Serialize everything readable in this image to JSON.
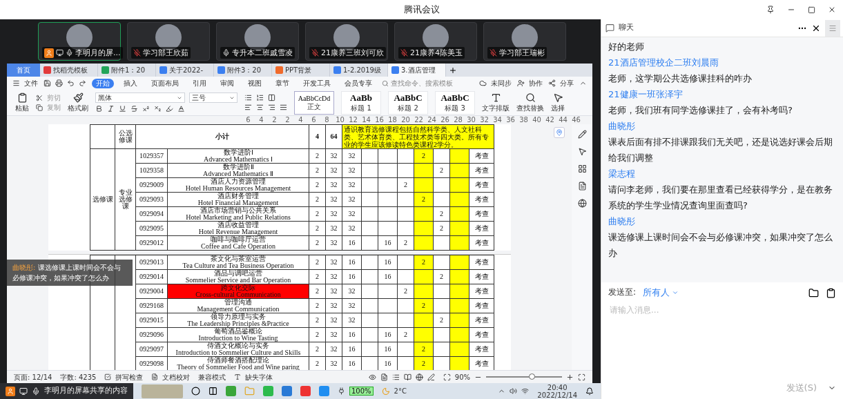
{
  "window": {
    "title": "腾讯会议"
  },
  "participants": [
    {
      "name": "李明月的屏...",
      "muted": false,
      "selected": true,
      "sharing": true
    },
    {
      "name": "学习部王欣茹",
      "muted": true,
      "selected": false,
      "sharing": false
    },
    {
      "name": "专升本二班戚雪凌",
      "muted": false,
      "selected": false,
      "sharing": false
    },
    {
      "name": "21康养三班刘可欣",
      "muted": true,
      "selected": false,
      "sharing": false
    },
    {
      "name": "21康养4陈美玉",
      "muted": true,
      "selected": false,
      "sharing": false
    },
    {
      "name": "学习部王瑞彬",
      "muted": true,
      "selected": false,
      "sharing": false
    }
  ],
  "wps": {
    "home_tab": "首页",
    "doc_tabs": [
      {
        "kind": "template",
        "label": "找稻壳模板",
        "selected": false
      },
      {
        "kind": "sheet",
        "label": "附件1：20",
        "selected": false
      },
      {
        "kind": "doc",
        "label": "关于2022-",
        "selected": false
      },
      {
        "kind": "doc",
        "label": "附件3：20",
        "selected": false
      },
      {
        "kind": "ppt",
        "label": "PPT背景",
        "selected": false
      },
      {
        "kind": "doc",
        "label": "1-2.2019级",
        "selected": false
      },
      {
        "kind": "doc",
        "label": "3.酒店管理",
        "selected": true
      }
    ],
    "file_menu": "文件",
    "ribbon_tabs": [
      {
        "label": "开始",
        "selected": true
      },
      {
        "label": "插入",
        "selected": false
      },
      {
        "label": "页面布局",
        "selected": false
      },
      {
        "label": "引用",
        "selected": false
      },
      {
        "label": "审阅",
        "selected": false
      },
      {
        "label": "视图",
        "selected": false
      },
      {
        "label": "章节",
        "selected": false
      },
      {
        "label": "开发工具",
        "selected": false
      },
      {
        "label": "会员专享",
        "selected": false
      }
    ],
    "command_search": {
      "placeholder": "查找命令、搜索模板"
    },
    "sync": "未同步",
    "collab": "协作",
    "share": "分享",
    "clipboard": {
      "paste": "粘贴",
      "cut": "剪切",
      "copy": "复制",
      "format_painter": "格式刷"
    },
    "font": {
      "family": "黑体",
      "size": "三号"
    },
    "styles": [
      {
        "preview": "AaBbCcDd",
        "label": "正文"
      },
      {
        "preview": "AaBb",
        "label": "标题 1"
      },
      {
        "preview": "AaBbC",
        "label": "标题 2"
      },
      {
        "preview": "AaBbC",
        "label": "标题 3"
      }
    ],
    "text_layout": "文字排版",
    "find_replace": "查找替换",
    "select": "选择",
    "ruler": [
      "6",
      "4",
      "2",
      "2",
      "4",
      "6",
      "8",
      "10",
      "12",
      "14",
      "16",
      "18",
      "20",
      "22",
      "24",
      "26",
      "28",
      "30",
      "32",
      "34",
      "36",
      "38",
      "40",
      "42",
      "44",
      "46"
    ],
    "document": {
      "category": "选修课",
      "public_group": "公选修课",
      "subtotal_label": "小计",
      "subtotal_credits": "4",
      "subtotal_hours": "64",
      "note": "通识教育选修课程包括自然科学类、人文社科类、艺术体育类、工程技术类等四大类。所有专业的学生应该修读特色类课程2学分。",
      "major_group": "专业选修课",
      "page1_rows": [
        {
          "code": "1029357",
          "name_cn": "数学进阶Ⅰ",
          "name_en": "Advanced Mathematics Ⅰ",
          "highlighted": false,
          "cells": [
            "2",
            "32",
            "32",
            "",
            "",
            "",
            "2",
            "",
            "",
            "考查"
          ]
        },
        {
          "code": "1029358",
          "name_cn": "数学进阶Ⅱ",
          "name_en": "Advanced Mathematics Ⅱ",
          "highlighted": false,
          "cells": [
            "2",
            "32",
            "32",
            "",
            "",
            "",
            "",
            "2",
            "",
            "考查"
          ]
        },
        {
          "code": "0929009",
          "name_cn": "酒店人力资源管理",
          "name_en": "Hotel Human Resources Management",
          "highlighted": false,
          "cells": [
            "2",
            "32",
            "32",
            "",
            "",
            "2",
            "",
            "",
            "",
            "考查"
          ]
        },
        {
          "code": "0929093",
          "name_cn": "酒店财务管理",
          "name_en": "Hotel Financial Management",
          "highlighted": false,
          "cells": [
            "2",
            "32",
            "32",
            "",
            "",
            "",
            "2",
            "",
            "",
            "考查"
          ]
        },
        {
          "code": "0929094",
          "name_cn": "酒店市场营销与公共关系",
          "name_en": "Hotel Marketing and Public Relations",
          "highlighted": false,
          "cells": [
            "2",
            "32",
            "32",
            "",
            "",
            "",
            "",
            "2",
            "",
            "考查"
          ]
        },
        {
          "code": "0929095",
          "name_cn": "酒店收益管理",
          "name_en": "Hotel Revenue Management",
          "highlighted": false,
          "cells": [
            "2",
            "32",
            "32",
            "",
            "",
            "",
            "",
            "2",
            "",
            "考查"
          ]
        },
        {
          "code": "0929012",
          "name_cn": "咖啡与咖啡厅运营",
          "name_en": "Coffee and Cafe Operation",
          "highlighted": false,
          "cells": [
            "2",
            "32",
            "16",
            "",
            "16",
            "2",
            "",
            "",
            "",
            "考查"
          ]
        }
      ],
      "page2_rows": [
        {
          "code": "0929013",
          "name_cn": "茶文化与茶室运营",
          "name_en": "Tea Culture and Tea Business Operation",
          "highlighted": false,
          "cells": [
            "2",
            "32",
            "16",
            "",
            "16",
            "",
            "2",
            "",
            "",
            "考查"
          ]
        },
        {
          "code": "0929014",
          "name_cn": "酒品与调吧运营",
          "name_en": "Sommelier Service and Bar Operation",
          "highlighted": false,
          "cells": [
            "2",
            "32",
            "16",
            "",
            "16",
            "",
            "",
            "2",
            "",
            "考查"
          ]
        },
        {
          "code": "0929004",
          "name_cn": "跨文化交际",
          "name_en": "Cross-cultural Communication",
          "highlighted": true,
          "cells": [
            "2",
            "32",
            "32",
            "",
            "",
            "2",
            "",
            "",
            "",
            "考查"
          ]
        },
        {
          "code": "0929168",
          "name_cn": "管理沟通",
          "name_en": "Management Communication",
          "highlighted": false,
          "cells": [
            "2",
            "32",
            "32",
            "",
            "",
            "",
            "2",
            "",
            "",
            "考查"
          ]
        },
        {
          "code": "0929015",
          "name_cn": "领导力原理与实务",
          "name_en": "The Leadership Principles &Practice",
          "highlighted": false,
          "cells": [
            "2",
            "32",
            "32",
            "",
            "",
            "",
            "",
            "2",
            "",
            "考查"
          ]
        },
        {
          "code": "0929096",
          "name_cn": "葡萄酒品鉴概论",
          "name_en": "Introduction to Wine Tasting",
          "highlighted": false,
          "cells": [
            "2",
            "32",
            "16",
            "",
            "16",
            "2",
            "",
            "",
            "",
            "考查"
          ]
        },
        {
          "code": "0929097",
          "name_cn": "侍酒文化概论与实务",
          "name_en": "Introduction to Sommelier Culture and Skills",
          "highlighted": false,
          "cells": [
            "2",
            "32",
            "16",
            "",
            "16",
            "",
            "2",
            "",
            "",
            "考查"
          ]
        },
        {
          "code": "0929098",
          "name_cn": "侍酒师餐酒搭配理论",
          "name_en": "Theory of Sommelier Food and Wine paring",
          "highlighted": false,
          "cells": [
            "2",
            "32",
            "16",
            "",
            "16",
            "",
            "2",
            "",
            "",
            "考查"
          ]
        }
      ]
    },
    "caption": {
      "speaker": "曲晓彤:",
      "text": "课选修课上课时间会不会与必修课冲突，如果冲突了怎么办"
    },
    "status": {
      "page": "页面: 12/14",
      "words": "字数: 4235",
      "spell": "拼写检查",
      "proof": "文档校对",
      "compat": "兼容模式",
      "missing_font": "缺失字体",
      "zoom": "90%",
      "zoom_level": {
        "level": 0.6
      }
    }
  },
  "taskbar": {
    "share_label": "李明月的屏幕共享的内容",
    "battery": "100%",
    "temperature": "2°C",
    "time": "20:40",
    "date": "2022/12/14"
  },
  "chat": {
    "title": "聊天",
    "messages": [
      {
        "kind": "text",
        "text": "好的老师"
      },
      {
        "kind": "sender",
        "text": "21酒店管理校企二班刘晨雨"
      },
      {
        "kind": "text",
        "text": "老师，这学期公共选修课挂科的咋办"
      },
      {
        "kind": "sender",
        "text": "21健康一班张泽宇"
      },
      {
        "kind": "text",
        "text": "老师，我们班有同学选修课挂了，会有补考吗?"
      },
      {
        "kind": "sender",
        "text": "曲晓彤"
      },
      {
        "kind": "text",
        "text": "课表后面有排不排课跟我们无关吧，还是说选好课会后期给我们调整"
      },
      {
        "kind": "sender",
        "text": "梁志程"
      },
      {
        "kind": "text",
        "text": "请问李老师，我们要在那里查看已经获得学分，是在教务系统的学生学业情况查询里面查吗?"
      },
      {
        "kind": "sender",
        "text": "曲晓彤"
      },
      {
        "kind": "text",
        "text": "课选修课上课时间会不会与必修课冲突，如果冲突了怎么办"
      }
    ],
    "send_to_label": "发送至:",
    "recipient": "所有人",
    "input": {
      "placeholder": "请输入消息..."
    },
    "send_button": {
      "label": "发送(S)",
      "disabled": true
    }
  }
}
